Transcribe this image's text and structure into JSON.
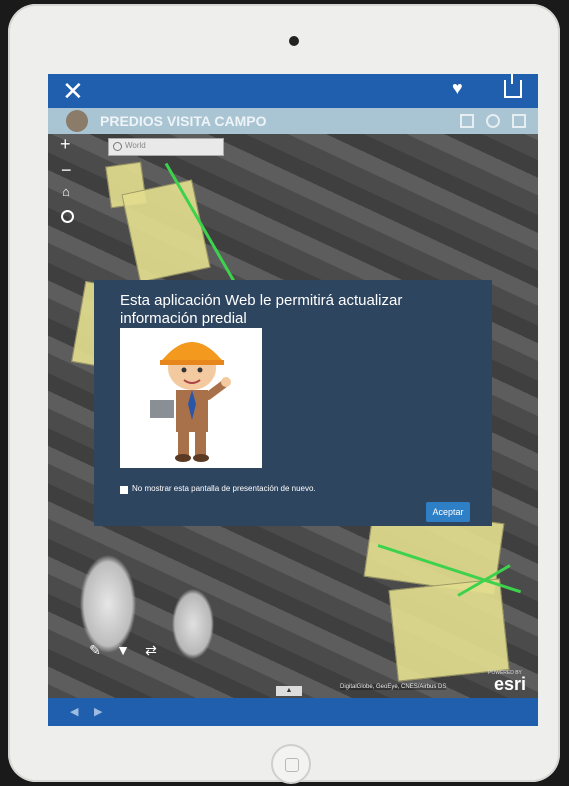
{
  "header": {
    "close_glyph": "✕",
    "heart_glyph": "♥"
  },
  "app": {
    "title": "PREDIOS VISITA CAMPO"
  },
  "map": {
    "zoom_in": "+",
    "zoom_out": "−",
    "search_placeholder": "World",
    "parcel_color": "#e2dd8e",
    "road_color": "#3cd24b"
  },
  "splash": {
    "title": "Esta aplicación Web le permitirá actualizar información predial",
    "checkbox_label": "No mostrar esta pantalla de presentación de nuevo.",
    "accept_label": "Aceptar"
  },
  "footer": {
    "attribution": "DigitalGlobe, GeoEye, CNES/Airbus DS",
    "esri_logo": "esri",
    "powered_by": "POWERED BY",
    "caret": "▲",
    "prev": "◀",
    "next": "▶"
  },
  "colors": {
    "topbar": "#1f5fae",
    "splash_bg": "#2e4560",
    "accept": "#2f7fc6"
  }
}
